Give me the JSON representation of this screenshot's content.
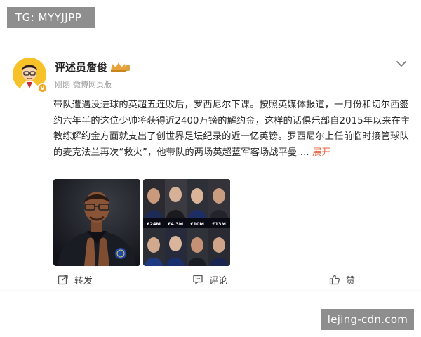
{
  "watermark_top": "TG: MYYJJPP",
  "watermark_bottom": "lejing-cdn.com",
  "post": {
    "username": "评述员詹俊",
    "time": "刚刚",
    "source": "微博网页版",
    "text": "带队遭遇没进球的英超五连败后，罗西尼尔下课。按照英媒体报道，一月份和切尔西签约六年半的这位少帅将获得近2400万镑的解约金，这样的话俱乐部自2015年以来在主教练解约金方面就支出了创世界足坛纪录的近一亿英镑。罗西尼尔上任前临时接管球队的麦克法兰再次“救火”，他带队的两场英超蓝军客场战平曼 ...",
    "expand_label": "展开",
    "images": [
      {
        "name": "coach-photo"
      },
      {
        "name": "managers-collage",
        "labels": [
          "£24M",
          "£4.3M",
          "£10M",
          "£13M"
        ]
      }
    ]
  },
  "actions": {
    "share_label": "转发",
    "comment_label": "评论",
    "like_label": "赞"
  },
  "icons": [
    "chevron-down-icon",
    "share-icon",
    "comment-icon",
    "like-icon",
    "crown-icon",
    "verified-icon"
  ],
  "colors": {
    "accent": "#e8603c",
    "badge": "#f5a623",
    "watermark_bg": "#8e8e8e"
  }
}
